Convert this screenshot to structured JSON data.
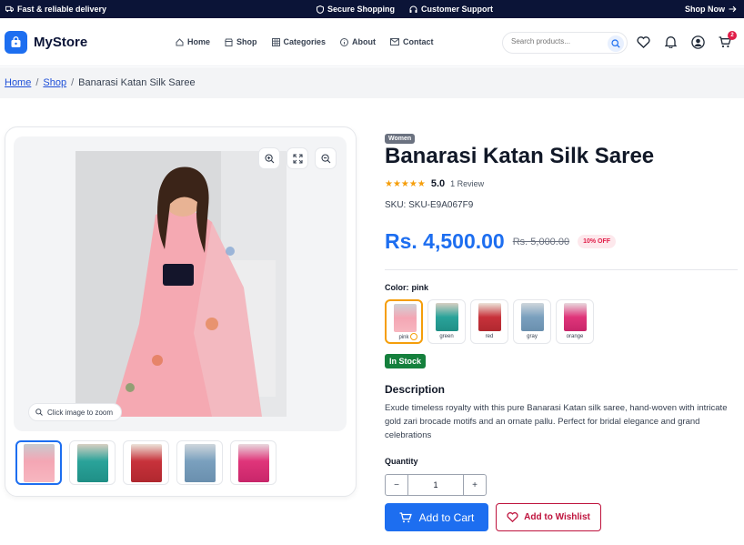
{
  "topbar": {
    "delivery": "Fast & reliable delivery",
    "secure": "Secure Shopping",
    "support": "Customer Support",
    "shop_now": "Shop Now"
  },
  "header": {
    "brand": "MyStore",
    "nav": [
      "Home",
      "Shop",
      "Categories",
      "About",
      "Contact"
    ],
    "search_placeholder": "Search products...",
    "cart_count": "2"
  },
  "breadcrumb": {
    "home": "Home",
    "shop": "Shop",
    "current": "Banarasi Katan Silk Saree"
  },
  "gallery": {
    "zoom_hint": "Click image to zoom",
    "thumb_colors": [
      "#f4a6b4",
      "#2aa39a",
      "#c8323b",
      "#7aa0be",
      "#e0357a"
    ],
    "main_color": "#f5a9b2"
  },
  "product": {
    "category": "Women",
    "title": "Banarasi Katan Silk Saree",
    "rating": "5.0",
    "stars": "★★★★★",
    "reviews": "1 Review",
    "sku": "SKU: SKU-E9A067F9",
    "price": "Rs. 4,500.00",
    "old_price": "Rs. 5,000.00",
    "discount": "10% OFF",
    "color_label": "Color:",
    "color_value": "pink",
    "colors": [
      {
        "name": "pink",
        "hex": "#f4a6b4"
      },
      {
        "name": "green",
        "hex": "#2aa39a"
      },
      {
        "name": "red",
        "hex": "#c8323b"
      },
      {
        "name": "gray",
        "hex": "#7aa0be"
      },
      {
        "name": "orange",
        "hex": "#e0357a"
      }
    ],
    "stock": "In Stock",
    "description_heading": "Description",
    "description": "Exude timeless royalty with this pure Banarasi Katan silk saree, hand-woven with intricate gold zari brocade motifs and an ornate pallu. Perfect for bridal elegance and grand celebrations",
    "quantity_label": "Quantity",
    "quantity": "1",
    "minus": "−",
    "plus": "+",
    "add_to_cart": "Add to Cart",
    "add_to_wishlist": "Add to Wishlist"
  }
}
